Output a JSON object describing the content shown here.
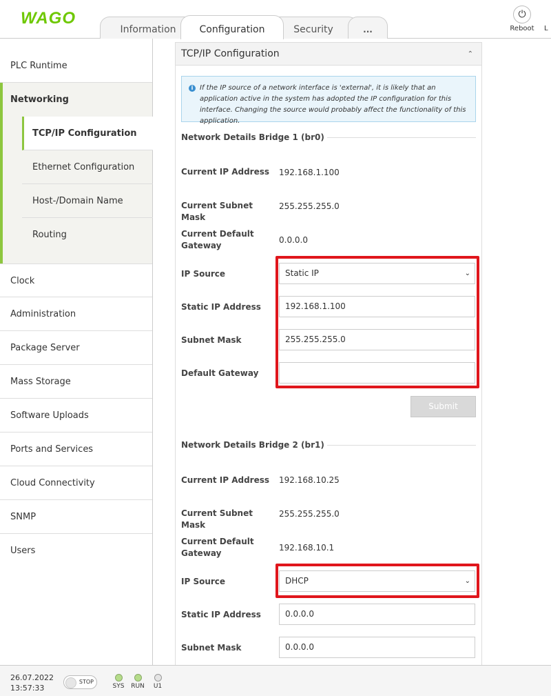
{
  "header": {
    "logo": "WAGO",
    "tabs": [
      "Information",
      "Configuration",
      "Security",
      "..."
    ],
    "reboot_label": "Reboot",
    "cut_label": "L"
  },
  "sidebar": {
    "items": [
      "PLC Runtime",
      "Networking",
      "Clock",
      "Administration",
      "Package Server",
      "Mass Storage",
      "Software Uploads",
      "Ports and Services",
      "Cloud Connectivity",
      "SNMP",
      "Users"
    ],
    "networking_sub": [
      "TCP/IP Configuration",
      "Ethernet Configuration",
      "Host-/Domain Name",
      "Routing"
    ]
  },
  "panel": {
    "title": "TCP/IP Configuration",
    "notice": "If the IP source of a network interface is 'external', it is likely that an application active in the system has adopted the IP configuration for this interface. Changing the source would probably affect the functionality of this application.",
    "bridge1": {
      "title": "Network Details Bridge 1 (br0)",
      "current_ip_label": "Current IP Address",
      "current_ip": "192.168.1.100",
      "current_mask_label": "Current Subnet Mask",
      "current_mask": "255.255.255.0",
      "current_gw_label": "Current Default Gateway",
      "current_gw": "0.0.0.0",
      "ip_source_label": "IP Source",
      "ip_source": "Static IP",
      "static_ip_label": "Static IP Address",
      "static_ip": "192.168.1.100",
      "subnet_label": "Subnet Mask",
      "subnet": "255.255.255.0",
      "gateway_label": "Default Gateway",
      "gateway": "",
      "submit": "Submit"
    },
    "bridge2": {
      "title": "Network Details Bridge 2 (br1)",
      "current_ip_label": "Current IP Address",
      "current_ip": "192.168.10.25",
      "current_mask_label": "Current Subnet Mask",
      "current_mask": "255.255.255.0",
      "current_gw_label": "Current Default Gateway",
      "current_gw": "192.168.10.1",
      "ip_source_label": "IP Source",
      "ip_source": "DHCP",
      "static_ip_label": "Static IP Address",
      "static_ip": "0.0.0.0",
      "subnet_label": "Subnet Mask",
      "subnet": "0.0.0.0"
    }
  },
  "footer": {
    "date": "26.07.2022",
    "time": "13:57:33",
    "stop_label": "STOP",
    "leds": [
      "SYS",
      "RUN",
      "U1"
    ]
  },
  "colors": {
    "brand_green": "#6ec800",
    "accent_green": "#8dc63f",
    "highlight_red": "#e0161c"
  },
  "icons": {
    "reboot": "power-icon",
    "panel_toggle": "chevron-up-icon",
    "notice": "info-icon",
    "select": "chevron-down-icon"
  }
}
